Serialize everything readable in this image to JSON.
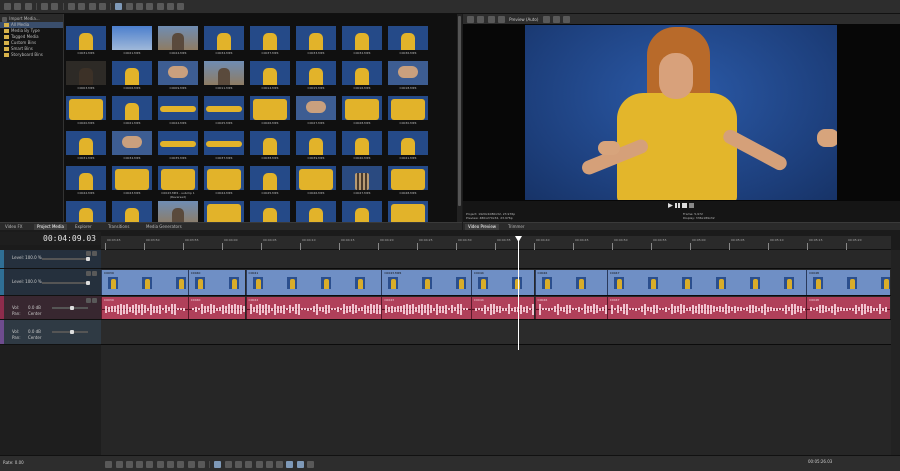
{
  "toolbar": {
    "import_label": "Import Media..."
  },
  "media_tree": {
    "items": [
      {
        "label": "All Media",
        "selected": true
      },
      {
        "label": "Media By Type",
        "selected": false
      },
      {
        "label": "Tagged Media",
        "selected": false
      },
      {
        "label": "Custom Bins",
        "selected": false
      },
      {
        "label": "Smart Bins",
        "selected": false
      },
      {
        "label": "Storyboard Bins",
        "selected": false
      }
    ]
  },
  "media_grid": [
    {
      "label": "C0031.MP4",
      "kind": "person"
    },
    {
      "label": "C0021.MP4",
      "kind": "sky"
    },
    {
      "label": "C0024.MP4",
      "kind": "out"
    },
    {
      "label": "C0034.MP4",
      "kind": "person"
    },
    {
      "label": "C0037.MP4",
      "kind": "person"
    },
    {
      "label": "C0033.MP4",
      "kind": "person"
    },
    {
      "label": "C0032.MP4",
      "kind": "person"
    },
    {
      "label": "C0036.MP4",
      "kind": "person"
    },
    {
      "label": "C0003.MP4",
      "kind": "dark"
    },
    {
      "label": "C0006.MP4",
      "kind": "person"
    },
    {
      "label": "C0009.MP4",
      "kind": "hands"
    },
    {
      "label": "C0011.MP4",
      "kind": "out"
    },
    {
      "label": "C0014.MP4",
      "kind": "person"
    },
    {
      "label": "C0015.MP4",
      "kind": "person"
    },
    {
      "label": "C0016.MP4",
      "kind": "person"
    },
    {
      "label": "C0018.MP4",
      "kind": "hands"
    },
    {
      "label": "C0020.MP4",
      "kind": "close"
    },
    {
      "label": "C0021.MP4",
      "kind": "person"
    },
    {
      "label": "C0024.MP4",
      "kind": "arm"
    },
    {
      "label": "C0025.MP4",
      "kind": "arm"
    },
    {
      "label": "C0026.MP4",
      "kind": "close"
    },
    {
      "label": "C0027.MP4",
      "kind": "hands"
    },
    {
      "label": "C0028.MP4",
      "kind": "close"
    },
    {
      "label": "C0030.MP4",
      "kind": "close"
    },
    {
      "label": "C0031.MP4",
      "kind": "person"
    },
    {
      "label": "C0034.MP4",
      "kind": "hands"
    },
    {
      "label": "C0035.MP4",
      "kind": "arm"
    },
    {
      "label": "C0037.MP4",
      "kind": "arm"
    },
    {
      "label": "C0038.MP4",
      "kind": "person"
    },
    {
      "label": "C0039.MP4",
      "kind": "person"
    },
    {
      "label": "C0040.MP4",
      "kind": "person"
    },
    {
      "label": "C0041.MP4",
      "kind": "person"
    },
    {
      "label": "C0042.MP4",
      "kind": "person"
    },
    {
      "label": "C0043.MP4",
      "kind": "close"
    },
    {
      "label": "C0043.MP4 - subclip 1 (Reversed)",
      "kind": "close"
    },
    {
      "label": "C0044.MP4",
      "kind": "close"
    },
    {
      "label": "C0045.MP4",
      "kind": "person"
    },
    {
      "label": "C0046.MP4",
      "kind": "close"
    },
    {
      "label": "C0047.MP4",
      "kind": "plaid"
    },
    {
      "label": "C0048.MP4",
      "kind": "close"
    },
    {
      "label": "",
      "kind": "person"
    },
    {
      "label": "",
      "kind": "person"
    },
    {
      "label": "",
      "kind": "out"
    },
    {
      "label": "",
      "kind": "close"
    },
    {
      "label": "",
      "kind": "person"
    },
    {
      "label": "",
      "kind": "person"
    },
    {
      "label": "",
      "kind": "person"
    },
    {
      "label": "",
      "kind": "close"
    }
  ],
  "preview": {
    "quality": "Preview (Auto)",
    "project_line": "Project:  1920x1080x32, 23.976p",
    "preview_line": "Preview:  480x270x32, 23.976p",
    "frame_line": "Frame:  5,972",
    "display_line": "Display:  336x189x32"
  },
  "tabs_left": [
    "Video FX",
    "Project Media",
    "Explorer",
    "Transitions",
    "Media Generators"
  ],
  "tabs_right": [
    "Video Preview",
    "Trimmer"
  ],
  "timeline": {
    "timecode": "00:04:09.03",
    "ruler_labels": [
      "00:03:45",
      "00:03:50",
      "00:03:55",
      "00:04:00",
      "00:04:05",
      "00:04:10",
      "00:04:15",
      "00:04:20",
      "00:04:25",
      "00:04:30",
      "00:04:35",
      "00:04:40",
      "00:04:45",
      "00:04:50",
      "00:04:55",
      "00:05:00",
      "00:05:05",
      "00:05:10",
      "00:05:15",
      "00:05:20"
    ],
    "track1": {
      "level": "Level: 100.0 %"
    },
    "track2": {
      "level": "Level: 100.0 %"
    },
    "audio1": {
      "vol": "Vol:",
      "vol_val": "0.0 dB",
      "pan": "Pan:",
      "pan_val": "Center"
    },
    "audio2": {
      "vol": "Vol:",
      "vol_val": "0.0 dB",
      "pan": "Pan:",
      "pan_val": "Center"
    },
    "video_clips": [
      {
        "name": "C0039",
        "start": 0,
        "end": 30
      },
      {
        "name": "C0040",
        "start": 30,
        "end": 50
      },
      {
        "name": "C0041",
        "start": 50,
        "end": 97
      },
      {
        "name": "C0043.MP4",
        "start": 97,
        "end": 128
      },
      {
        "name": "C0044",
        "start": 128,
        "end": 150
      },
      {
        "name": "C0046",
        "start": 150,
        "end": 175
      },
      {
        "name": "C0047",
        "start": 175,
        "end": 244
      },
      {
        "name": "C0048",
        "start": 244,
        "end": 273
      }
    ],
    "audio_clips": [
      {
        "name": "C0039",
        "start": 0,
        "end": 30
      },
      {
        "name": "C0040",
        "start": 30,
        "end": 50
      },
      {
        "name": "C0042",
        "start": 50,
        "end": 97
      },
      {
        "name": "C0043",
        "start": 97,
        "end": 128
      },
      {
        "name": "C0044",
        "start": 128,
        "end": 150
      },
      {
        "name": "C0046",
        "start": 150,
        "end": 175
      },
      {
        "name": "C0047",
        "start": 175,
        "end": 244
      },
      {
        "name": "C0048",
        "start": 244,
        "end": 273
      }
    ],
    "cursor_time": "00:04:09.03",
    "view_start_seconds": 223,
    "view_end_seconds": 323
  },
  "status": {
    "rate": "Rate: 0.00",
    "end_time": "00:05:26.03"
  },
  "colors": {
    "video_clip": "#6f8fc5",
    "audio_clip": "#b0405a",
    "selection_tree": "#3a4e6c"
  }
}
